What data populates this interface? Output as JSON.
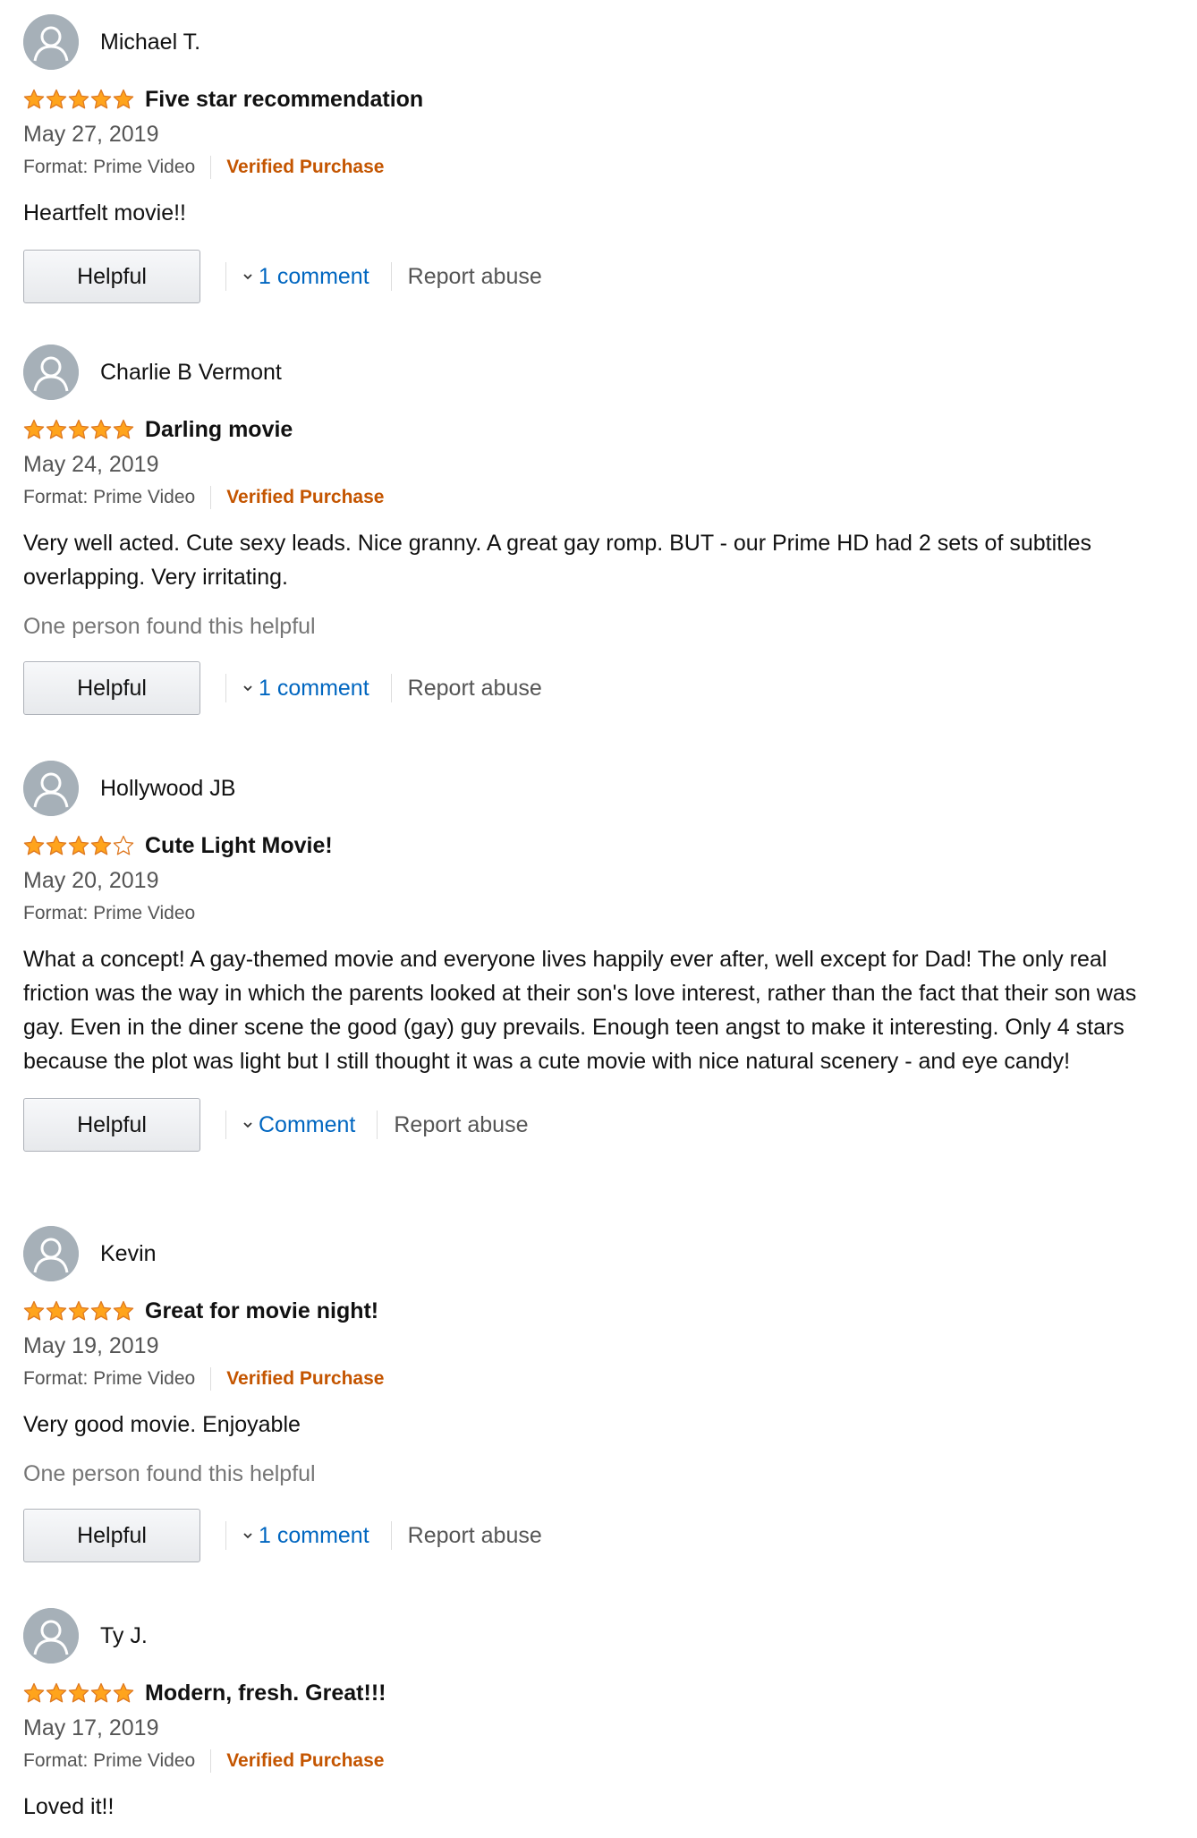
{
  "colors": {
    "star_fill": "#ffa41c",
    "star_stroke": "#de7921",
    "verified": "#c45500",
    "link": "#0066c0",
    "avatar_bg": "#a6b0b8"
  },
  "labels": {
    "format": "Format: Prime Video",
    "verified": "Verified Purchase",
    "helpful_button": "Helpful",
    "report": "Report abuse"
  },
  "reviews": [
    {
      "name": "Michael T.",
      "rating": 5,
      "title": "Five star recommendation",
      "date": "May 27, 2019",
      "verified": true,
      "body": "Heartfelt movie!!",
      "helpful_count": "",
      "comment_label": "1 comment"
    },
    {
      "name": "Charlie B Vermont",
      "rating": 5,
      "title": "Darling movie",
      "date": "May 24, 2019",
      "verified": true,
      "body": "Very well acted. Cute sexy leads. Nice granny. A great gay romp. BUT - our Prime HD had 2 sets of subtitles overlapping. Very irritating.",
      "helpful_count": "One person found this helpful",
      "comment_label": "1 comment"
    },
    {
      "name": "Hollywood JB",
      "rating": 4,
      "title": "Cute Light Movie!",
      "date": "May 20, 2019",
      "verified": false,
      "body": "What a concept! A gay-themed movie and everyone lives happily ever after, well except for Dad! The only real friction was the way in which the parents looked at their son's love interest, rather than the fact that their son was gay. Even in the diner scene the good (gay) guy prevails. Enough teen angst to make it interesting. Only 4 stars because the plot was light but I still thought it was a cute movie with nice natural scenery - and eye candy!",
      "helpful_count": "",
      "comment_label": "Comment"
    },
    {
      "name": "Kevin",
      "rating": 5,
      "title": "Great for movie night!",
      "date": "May 19, 2019",
      "verified": true,
      "body": "Very good movie. Enjoyable",
      "helpful_count": "One person found this helpful",
      "comment_label": "1 comment"
    },
    {
      "name": "Ty J.",
      "rating": 5,
      "title": "Modern, fresh. Great!!!",
      "date": "May 17, 2019",
      "verified": true,
      "body": "Loved it!!",
      "helpful_count": "",
      "comment_label": ""
    }
  ]
}
